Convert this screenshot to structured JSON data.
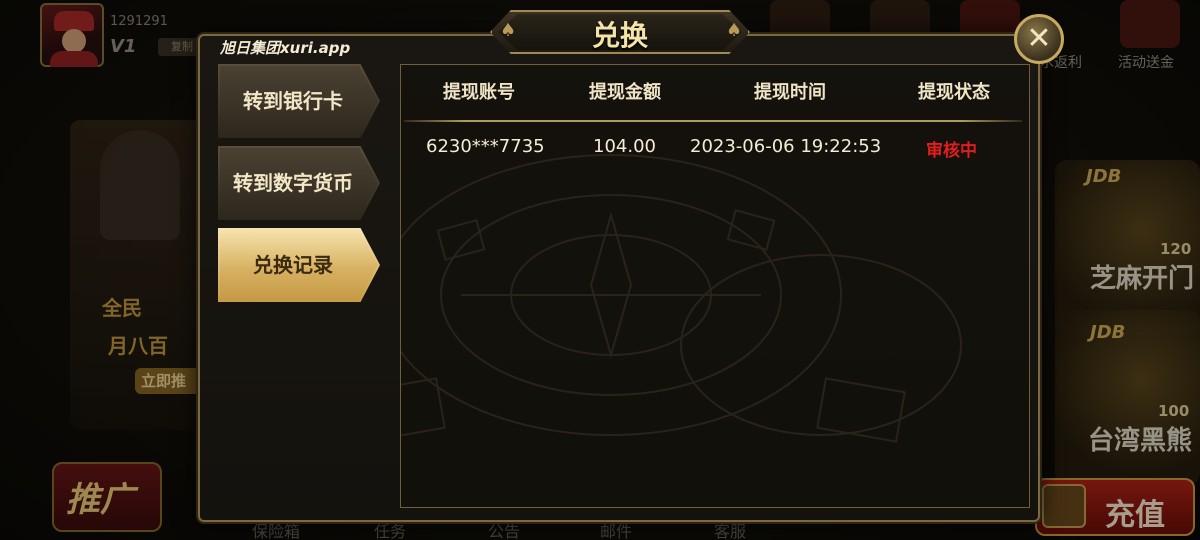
{
  "profile": {
    "uid": "1291291",
    "vip": "V1",
    "copy_label": "复制"
  },
  "promo": {
    "text1": "全民",
    "text2": "月八百",
    "button": "立即推"
  },
  "spread_label": "推广",
  "top_bar": {
    "rebate_label": "水返利",
    "event_label": "活动送金"
  },
  "games": [
    {
      "provider": "JDB",
      "number": "120",
      "name": "芝麻开门"
    },
    {
      "provider": "JDB",
      "number": "100",
      "name": "台湾黑熊"
    }
  ],
  "recharge_label": "充值",
  "bottom_nav": [
    "保险箱",
    "任务",
    "公告",
    "邮件",
    "客服"
  ],
  "dialog": {
    "title": "兑换",
    "brand": "旭日集团xuri.app",
    "tabs": [
      {
        "label": "转到银行卡",
        "active": false
      },
      {
        "label": "转到数字货币",
        "active": false
      },
      {
        "label": "兑换记录",
        "active": true
      }
    ],
    "table": {
      "headers": [
        "提现账号",
        "提现金额",
        "提现时间",
        "提现状态"
      ],
      "rows": [
        {
          "account": "6230***7735",
          "amount": "104.00",
          "time": "2023-06-06 19:22:53",
          "status": "审核中"
        }
      ]
    }
  },
  "colors": {
    "accent_gold": "#c79c48",
    "status_pending": "#e01e1e",
    "panel_border": "#7c6a3e"
  }
}
